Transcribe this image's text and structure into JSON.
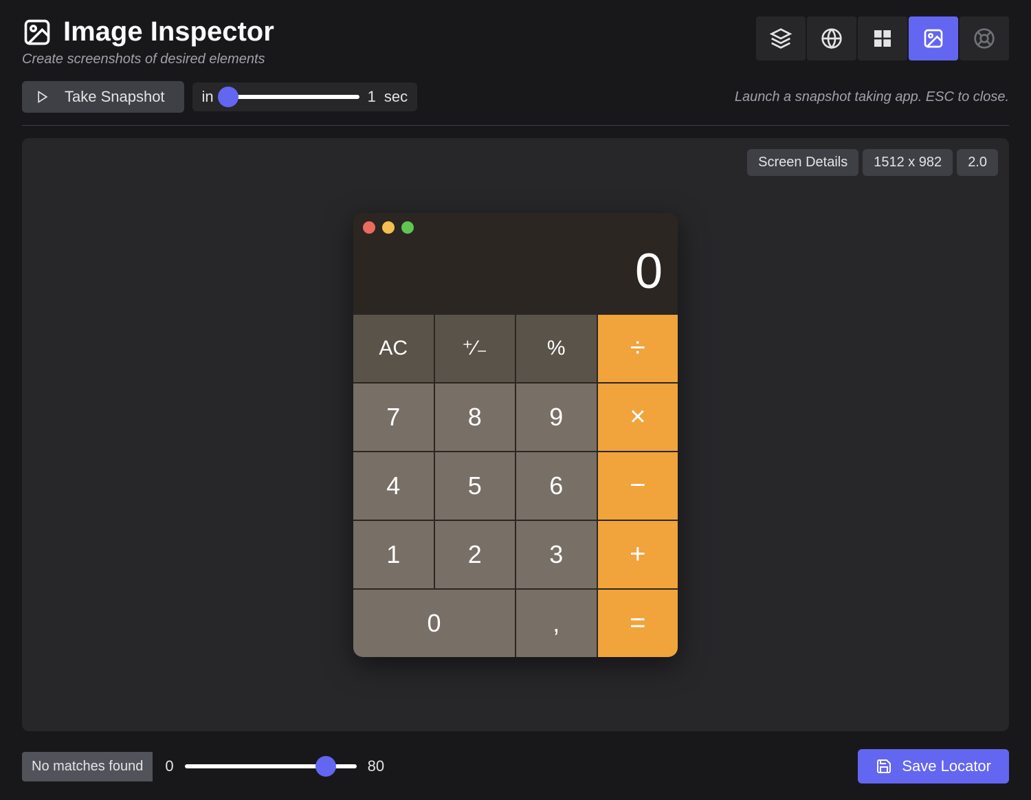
{
  "header": {
    "title": "Image Inspector",
    "subtitle": "Create screenshots of desired elements"
  },
  "tabs": {
    "items": [
      "layers",
      "globe",
      "windows",
      "image",
      "help"
    ],
    "active_index": 3
  },
  "actions": {
    "snapshot_label": "Take Snapshot",
    "delay_prefix": "in",
    "delay_value": "1",
    "delay_unit": "sec",
    "hint": "Launch a snapshot taking app. ESC to close."
  },
  "details": {
    "label": "Screen Details",
    "resolution": "1512 x 982",
    "scale": "2.0"
  },
  "calculator": {
    "display": "0",
    "rows": [
      [
        "AC",
        "⁺∕₋",
        "%",
        "÷"
      ],
      [
        "7",
        "8",
        "9",
        "×"
      ],
      [
        "4",
        "5",
        "6",
        "−"
      ],
      [
        "1",
        "2",
        "3",
        "+"
      ],
      [
        "0",
        ",",
        "="
      ]
    ]
  },
  "footer": {
    "match_status": "No matches found",
    "range_min": "0",
    "range_max": "80",
    "save_label": "Save Locator"
  }
}
